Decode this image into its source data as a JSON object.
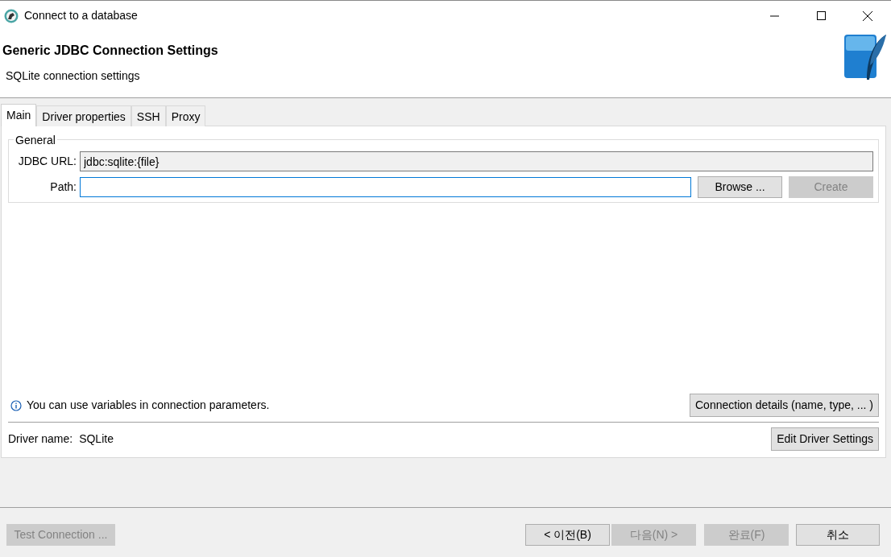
{
  "window": {
    "title": "Connect to a database"
  },
  "header": {
    "title": "Generic JDBC Connection Settings",
    "subtitle": "SQLite connection settings"
  },
  "tabs": [
    {
      "label": "Main",
      "selected": true
    },
    {
      "label": "Driver properties",
      "selected": false
    },
    {
      "label": "SSH",
      "selected": false
    },
    {
      "label": "Proxy",
      "selected": false
    }
  ],
  "general": {
    "legend": "General",
    "jdbc_url": {
      "label": "JDBC URL:",
      "value": "jdbc:sqlite:{file}"
    },
    "path": {
      "label": "Path:"
    },
    "buttons": [
      {
        "label": "Browse ...",
        "disabled": false
      },
      {
        "label": "Create",
        "disabled": true
      }
    ]
  },
  "info": "You can use variables in connection parameters.",
  "connection_details_button": "Connection details (name, type, ... )",
  "driver": {
    "label": "Driver name:",
    "value": "SQLite",
    "button": "Edit Driver Settings"
  },
  "footer": {
    "test_button": {
      "label": "Test Connection ...",
      "disabled": true
    },
    "buttons": [
      {
        "label": "< 이전(B)",
        "disabled": false
      },
      {
        "label": "다음(N) >",
        "disabled": true
      },
      {
        "label": "완료(F)",
        "disabled": true
      },
      {
        "label": "취소",
        "disabled": false
      }
    ]
  }
}
